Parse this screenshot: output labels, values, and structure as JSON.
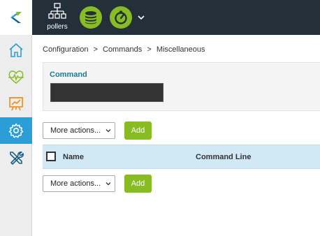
{
  "topbar": {
    "pollers_label": "pollers",
    "icons": [
      "pollers-icon",
      "database-icon",
      "gauge-icon",
      "chevron-down-icon"
    ]
  },
  "sidebar": {
    "items": [
      {
        "icon": "home-icon",
        "active": false
      },
      {
        "icon": "heartbeat-icon",
        "active": false
      },
      {
        "icon": "presentation-chart-icon",
        "active": false
      },
      {
        "icon": "gear-icon",
        "active": true
      },
      {
        "icon": "wrench-screwdriver-icon",
        "active": false
      }
    ]
  },
  "breadcrumb": [
    "Configuration",
    ">",
    "Commands",
    ">",
    "Miscellaneous"
  ],
  "filter": {
    "label": "Command",
    "value": ""
  },
  "actions_top": {
    "select_label": "More actions...",
    "add_label": "Add"
  },
  "table": {
    "columns": [
      "Name",
      "Command Line"
    ]
  },
  "actions_bottom": {
    "select_label": "More actions...",
    "add_label": "Add"
  },
  "colors": {
    "topbar": "#232f39",
    "accent_green": "#87bd23",
    "active_blue": "#2b9ed8",
    "table_header": "#d1e9f5",
    "filter_label": "#1e7a94"
  }
}
